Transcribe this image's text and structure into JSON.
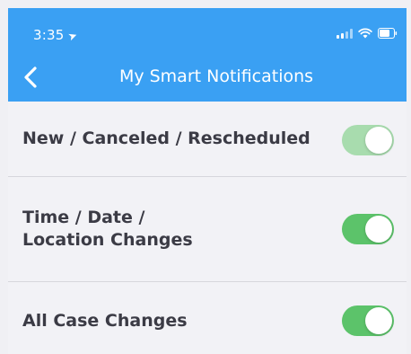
{
  "status_bar": {
    "time": "3:35",
    "location_icon": "location-arrow-icon"
  },
  "nav": {
    "back_icon": "chevron-left-icon",
    "title": "My Smart Notifications"
  },
  "settings": [
    {
      "label": "New / Canceled / Rescheduled",
      "enabled": true
    },
    {
      "label_line1": "Time / Date /",
      "label_line2": "Location Changes",
      "enabled": true
    },
    {
      "label": "All Case Changes",
      "enabled": true
    }
  ],
  "colors": {
    "header_bg": "#3aa0f3",
    "toggle_on": "#5cc36a",
    "label_text": "#3b3b45"
  }
}
